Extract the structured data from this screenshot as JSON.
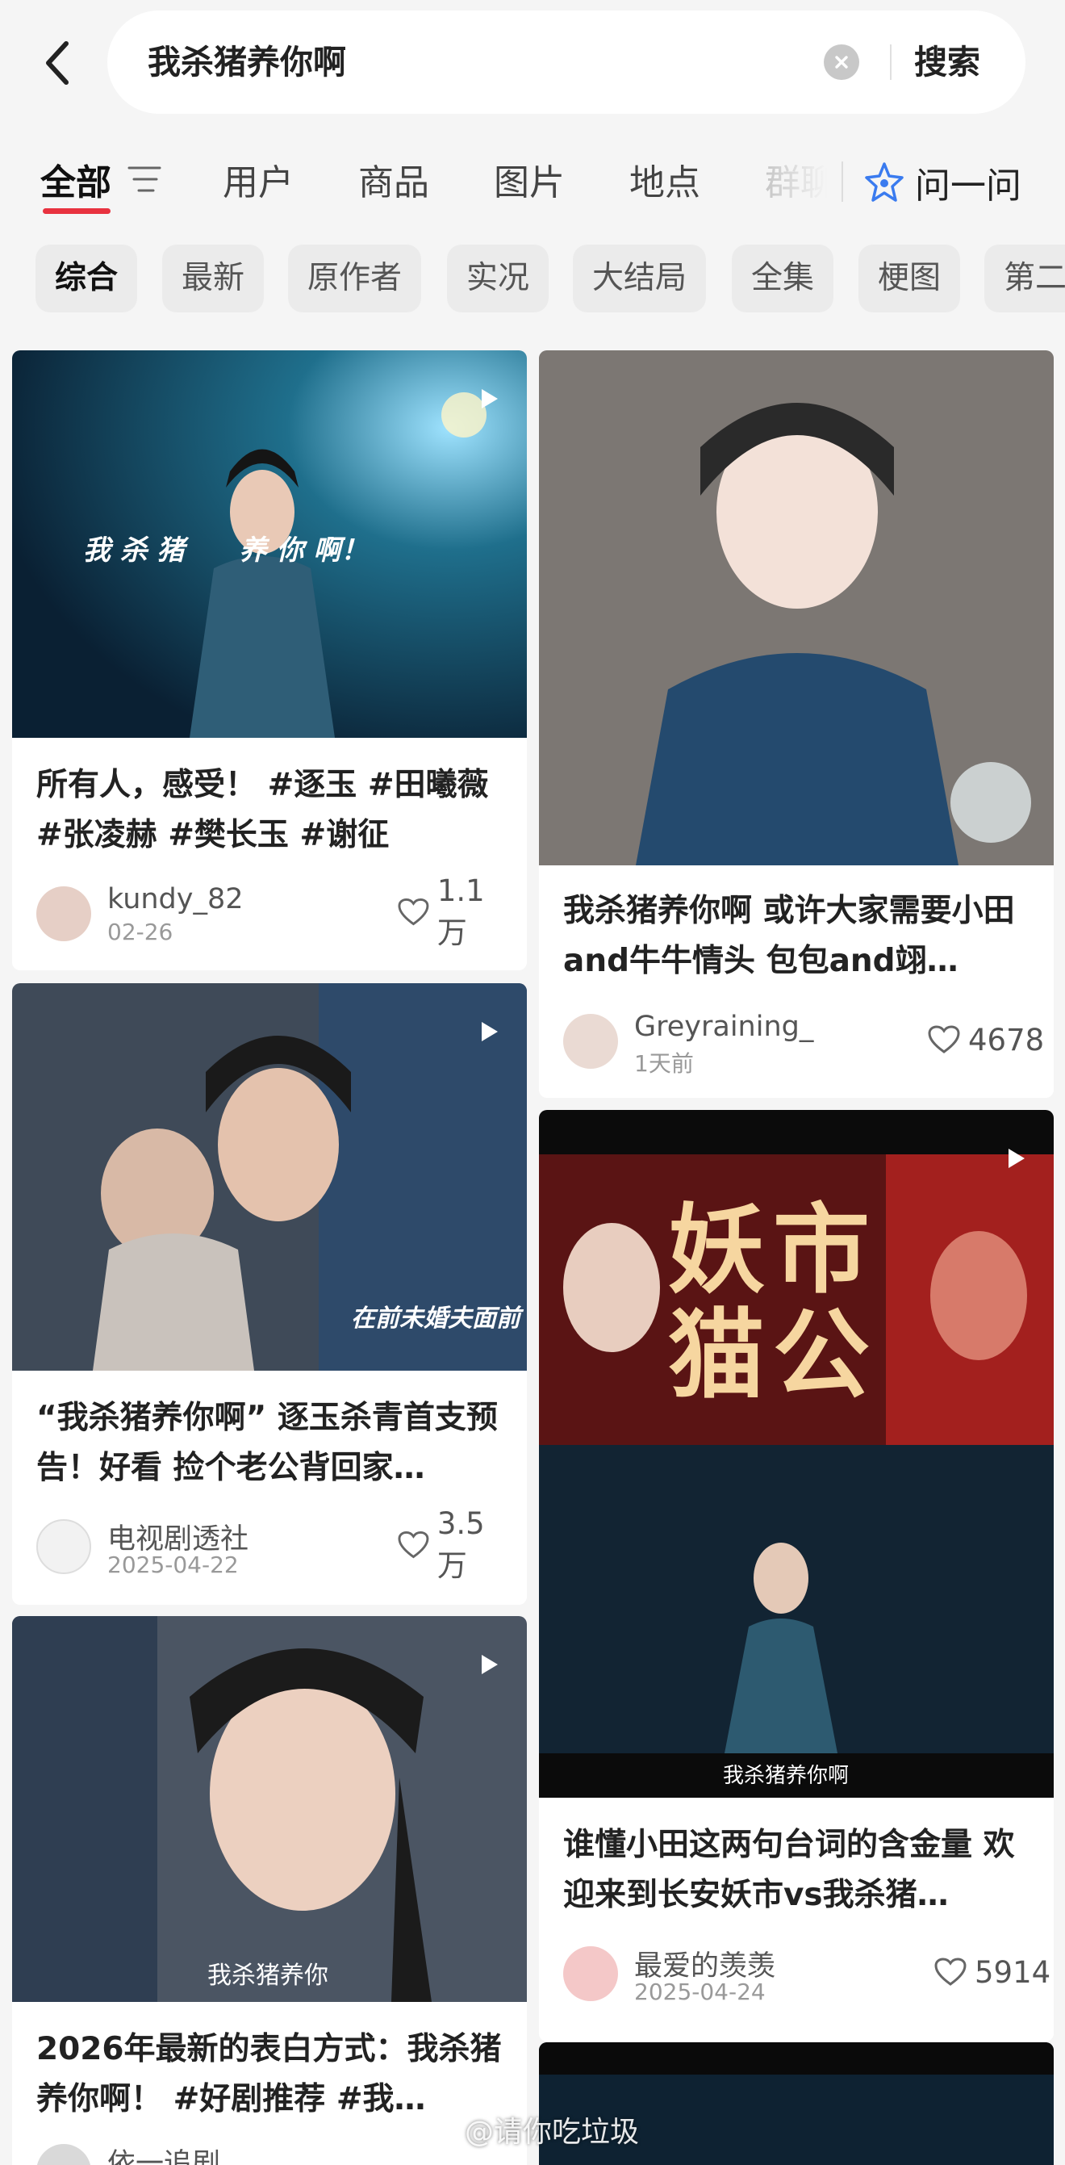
{
  "search": {
    "query": "我杀猪养你啊",
    "submit_label": "搜索"
  },
  "tabs": [
    {
      "label": "全部",
      "active": true
    },
    {
      "label": "用户"
    },
    {
      "label": "商品"
    },
    {
      "label": "图片"
    },
    {
      "label": "地点"
    },
    {
      "label": "群聊"
    }
  ],
  "ask": {
    "label": "问一问"
  },
  "chips": [
    "综合",
    "最新",
    "原作者",
    "实况",
    "大结局",
    "全集",
    "梗图",
    "第二"
  ],
  "cards": [
    {
      "title": "所有人，感受！ #逐玉 #田曦薇 #张凌赫 #樊长玉 #谢征",
      "author": "kundy_82",
      "date": "02-26",
      "likes": "1.1万",
      "overlay": "我 杀 猪　　养 你 啊！",
      "is_video": true
    },
    {
      "title": "我杀猪养你啊 或许大家需要小田and牛牛情头 包包and翊…",
      "author": "Greyraining_",
      "date": "1天前",
      "likes": "4678",
      "is_video": false
    },
    {
      "title": "“我杀猪养你啊” 逐玉杀青首支预告！好看 捡个老公背回家…",
      "author": "电视剧透社",
      "date": "2025-04-22",
      "likes": "3.5万",
      "overlay": "在前未婚夫面前",
      "is_video": true
    },
    {
      "title": "谁懂小田这两句台词的含金量 欢迎来到长安妖市vs我杀猪…",
      "author": "最爱的羡羡",
      "date": "2025-04-24",
      "likes": "5914",
      "overlay": "我杀猪养你啊",
      "poster_text": "妖市猫公",
      "is_video": true
    },
    {
      "title": "2026年最新的表白方式：我杀猪养你啊！ #好剧推荐 #我…",
      "author": "依一追剧",
      "date": "",
      "likes": "",
      "overlay": "我杀猪养你",
      "is_video": true
    }
  ],
  "watermark": "@请你吃垃圾",
  "colors": {
    "accent": "#e8323f",
    "background": "#f5f5f5",
    "card": "#ffffff"
  }
}
